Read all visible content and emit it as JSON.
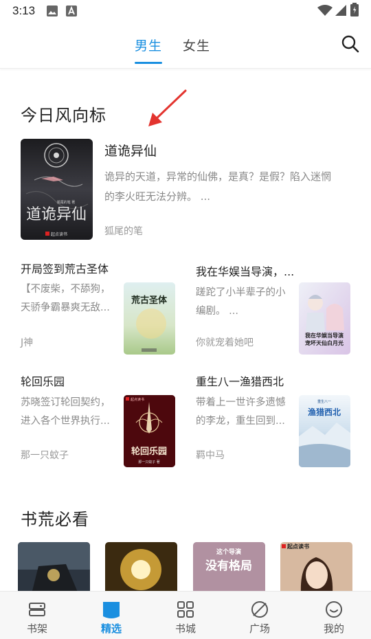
{
  "status": {
    "time": "3:13"
  },
  "tabs": [
    {
      "label": "男生",
      "active": true
    },
    {
      "label": "女生",
      "active": false
    }
  ],
  "sections": {
    "trending_title": "今日风向标",
    "must_read_title": "书荒必看"
  },
  "featured": {
    "title": "道诡异仙",
    "desc_line1": "诡异的天道，异常的仙佛，是真？是假？陷入迷惘",
    "desc_line2": "的李火旺无法分辨。 ...",
    "author": "狐尾的笔",
    "cover_text": "道诡异仙",
    "cover_badge": "起点读书",
    "cover_author": "狐尾的笔 著"
  },
  "grid_books": [
    {
      "title": "开局签到荒古圣体",
      "desc1": "【不废柴，不舔狗，",
      "desc2": "天骄争霸暴爽无敌...",
      "author": "J神",
      "cover_text": "荒古圣体"
    },
    {
      "title": "我在华娱当导演，...",
      "desc1": "蹉跎了小半辈子的小",
      "desc2": "编剧。 ...",
      "author": "你就宠着她吧",
      "cover_text1": "我在华娱当导演",
      "cover_text2": "宠坏天仙白月光"
    },
    {
      "title": "轮回乐园",
      "desc1": "苏晓签订轮回契约，",
      "desc2": "进入各个世界执行...",
      "author": "那一只蚊子",
      "cover_text": "轮回乐园",
      "cover_badge": "起点读书",
      "cover_author": "那一只蚊子 著"
    },
    {
      "title": "重生八一渔猎西北",
      "desc1": "带着上一世许多遗憾",
      "desc2": "的李龙，重生回到...",
      "author": "羁中马",
      "cover_text": "渔猎西北",
      "cover_top": "重生八一"
    }
  ],
  "strip_covers": [
    {
      "text": ""
    },
    {
      "text": ""
    },
    {
      "text1": "这个导演",
      "text2": "没有格局"
    },
    {
      "text": "起点读书"
    }
  ],
  "bottom_nav": [
    {
      "label": "书架",
      "icon": "bookshelf-icon",
      "active": false
    },
    {
      "label": "精选",
      "icon": "featured-icon",
      "active": true
    },
    {
      "label": "书城",
      "icon": "grid-icon",
      "active": false
    },
    {
      "label": "广场",
      "icon": "square-icon",
      "active": false
    },
    {
      "label": "我的",
      "icon": "profile-icon",
      "active": false
    }
  ],
  "colors": {
    "accent": "#1a8fe0",
    "text": "#222222",
    "muted": "#888888"
  }
}
